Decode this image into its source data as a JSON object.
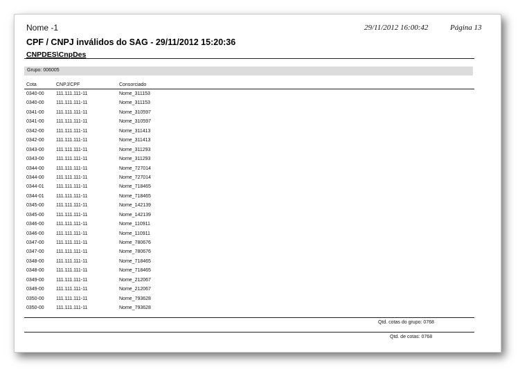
{
  "header": {
    "report_name": "Nome -1",
    "datetime": "29/11/2012 16:00:42",
    "page": "Página 13"
  },
  "title": "CPF / CNPJ inválidos do SAG - 29/11/2012  15:20:36",
  "subtitle": "CNPDES\\CnpDes",
  "group_label": "Grupo: 006005",
  "columns": [
    "Cota",
    "CNPJ/CPF",
    "Consorciado"
  ],
  "rows": [
    [
      "0340-00",
      "111.111.111-11",
      "Nome_311153"
    ],
    [
      "0340-00",
      "111.111.111-11",
      "Nome_311153"
    ],
    [
      "0341-00",
      "111.111.111-11",
      "Nome_310597"
    ],
    [
      "0341-00",
      "111.111.111-11",
      "Nome_310597"
    ],
    [
      "0342-00",
      "111.111.111-11",
      "Nome_311413"
    ],
    [
      "0342-00",
      "111.111.111-11",
      "Nome_311413"
    ],
    [
      "0343-00",
      "111.111.111-11",
      "Nome_311293"
    ],
    [
      "0343-00",
      "111.111.111-11",
      "Nome_311293"
    ],
    [
      "0344-00",
      "111.111.111-11",
      "Nome_727014"
    ],
    [
      "0344-00",
      "111.111.111-11",
      "Nome_727014"
    ],
    [
      "0344-01",
      "111.111.111-11",
      "Nome_718465"
    ],
    [
      "0344-01",
      "111.111.111-11",
      "Nome_718465"
    ],
    [
      "0345-00",
      "111.111.111-11",
      "Nome_142139"
    ],
    [
      "0345-00",
      "111.111.111-11",
      "Nome_142139"
    ],
    [
      "0346-00",
      "111.111.111-11",
      "Nome_110911"
    ],
    [
      "0346-00",
      "111.111.111-11",
      "Nome_110911"
    ],
    [
      "0347-00",
      "111.111.111-11",
      "Nome_780676"
    ],
    [
      "0347-00",
      "111.111.111-11",
      "Nome_780676"
    ],
    [
      "0348-00",
      "111.111.111-11",
      "Nome_718465"
    ],
    [
      "0348-00",
      "111.111.111-11",
      "Nome_718465"
    ],
    [
      "0349-00",
      "111.111.111-11",
      "Nome_212067"
    ],
    [
      "0349-00",
      "111.111.111-11",
      "Nome_212067"
    ],
    [
      "0350-00",
      "111.111.111-11",
      "Nome_793628"
    ],
    [
      "0350-00",
      "111.111.111-11",
      "Nome_793628"
    ]
  ],
  "totals": {
    "group": "Qtd. cotas do grupo:   0768",
    "overall": "Qtd. de cotas:   0768"
  },
  "colors": {
    "group_bar": "#dcdcdc",
    "page_bg": "#ffffff"
  }
}
